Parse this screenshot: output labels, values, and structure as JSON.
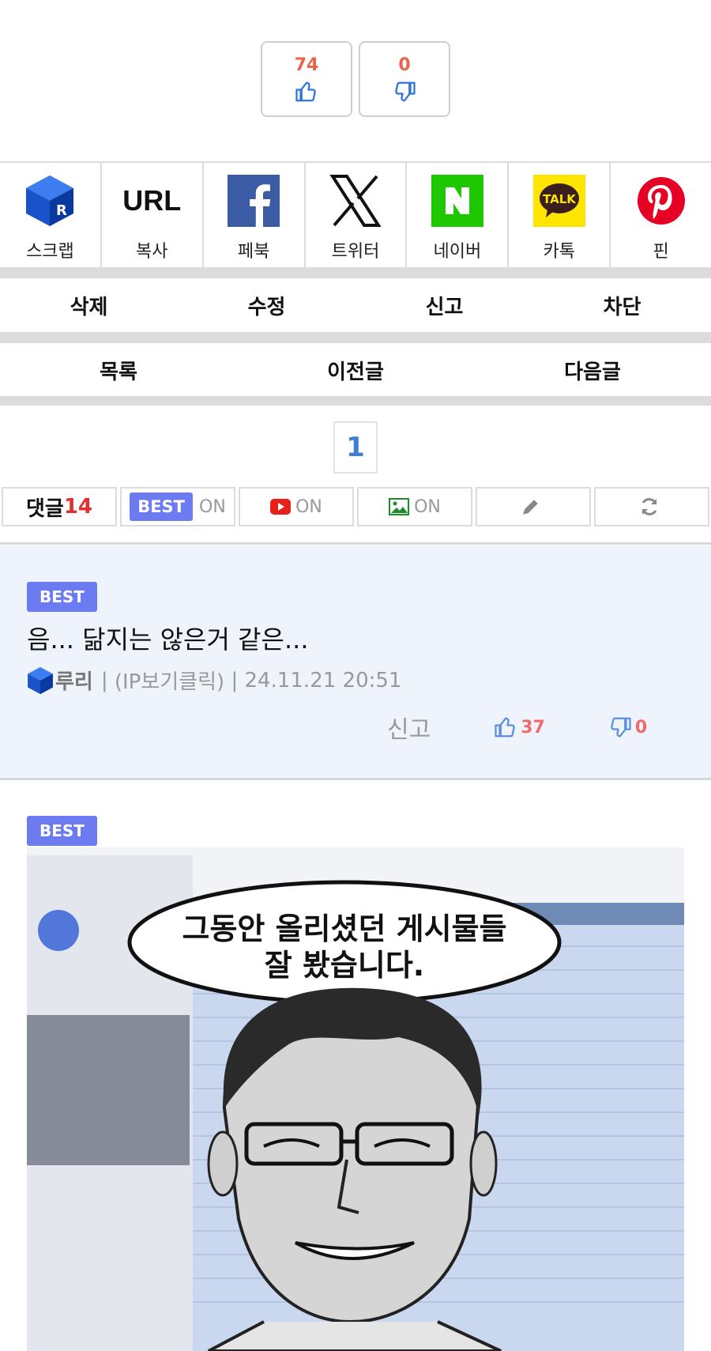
{
  "vote": {
    "likes": "74",
    "dislikes": "0"
  },
  "share": [
    {
      "label": "스크랩",
      "icon": "scrap-icon"
    },
    {
      "label": "복사",
      "icon": "url-icon",
      "title": "URL"
    },
    {
      "label": "페북",
      "icon": "facebook-icon"
    },
    {
      "label": "트위터",
      "icon": "x-icon"
    },
    {
      "label": "네이버",
      "icon": "naver-icon"
    },
    {
      "label": "카톡",
      "icon": "kakaotalk-icon",
      "badge": "TALK"
    },
    {
      "label": "핀",
      "icon": "pinterest-icon"
    }
  ],
  "post_actions": [
    "삭제",
    "수정",
    "신고",
    "차단"
  ],
  "nav_actions": [
    "목록",
    "이전글",
    "다음글"
  ],
  "pager": {
    "current": "1"
  },
  "toolbar": {
    "comment_label": "댓글",
    "comment_count": "14",
    "best_label": "BEST",
    "best_state": "ON",
    "video_state": "ON",
    "image_state": "ON"
  },
  "comments": [
    {
      "badge": "BEST",
      "text": "음... 닮지는 않은거 같은...",
      "author": "루리",
      "ip": "(IP보기클릭)",
      "date": "24.11.21 20:51",
      "report": "신고",
      "likes": "37",
      "dislikes": "0"
    },
    {
      "badge": "BEST",
      "image_caption": "그동안 올리셨던 게시물들\n잘 봤습니다."
    }
  ],
  "colors": {
    "accent": "#6c7bef",
    "vote": "#e8644c",
    "link": "#3f7fd6",
    "comment_bg": "#eff3fb"
  }
}
